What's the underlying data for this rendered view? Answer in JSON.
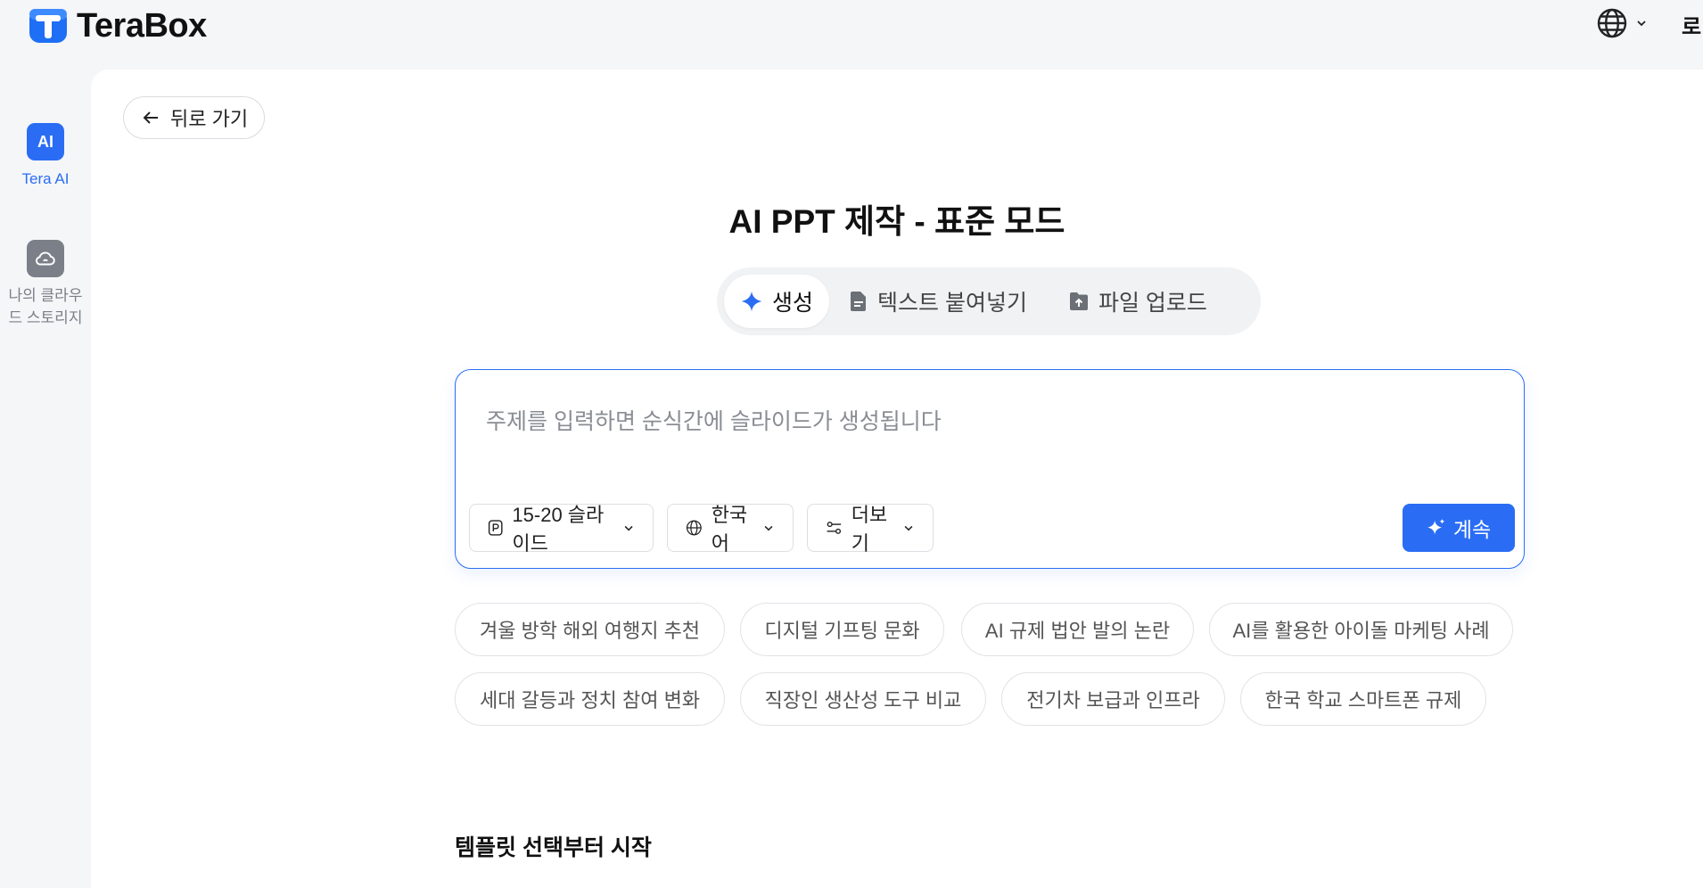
{
  "app": {
    "name": "TeraBox",
    "brand_color": "#2a6df4"
  },
  "topbar": {
    "language_icon": "globe-icon",
    "cut_text": "로"
  },
  "sidebar": {
    "items": [
      {
        "label": "Tera AI",
        "icon": "ai-icon",
        "badge": "AI",
        "active": true,
        "color": "#2a6df4"
      },
      {
        "label": "나의 클라우드 스토리지",
        "icon": "cloud-icon",
        "active": false,
        "color": "#7b7f87"
      }
    ]
  },
  "back": {
    "label": "뒤로 가기"
  },
  "page": {
    "title": "AI PPT 제작 - 표준 모드"
  },
  "mode_tabs": [
    {
      "label": "생성",
      "icon": "sparkle-icon",
      "active": true
    },
    {
      "label": "텍스트 붙여넣기",
      "icon": "document-icon",
      "active": false
    },
    {
      "label": "파일 업로드",
      "icon": "upload-icon",
      "active": false
    }
  ],
  "prompt": {
    "placeholder": "주제를 입력하면 순식간에 슬라이드가 생성됩니다",
    "value": "",
    "slides_option": "15-20 슬라이드",
    "language_option": "한국어",
    "more_option": "더보기",
    "continue_label": "계속"
  },
  "suggestions": [
    "겨울 방학 해외 여행지 추천",
    "디지털 기프팅 문화",
    "AI 규제 법안 발의 논란",
    "AI를 활용한 아이돌 마케팅 사례",
    "세대 갈등과 정치 참여 변화",
    "직장인 생산성 도구 비교",
    "전기차 보급과 인프라",
    "한국 학교 스마트폰 규제"
  ],
  "templates": {
    "title": "템플릿 선택부터 시작"
  }
}
